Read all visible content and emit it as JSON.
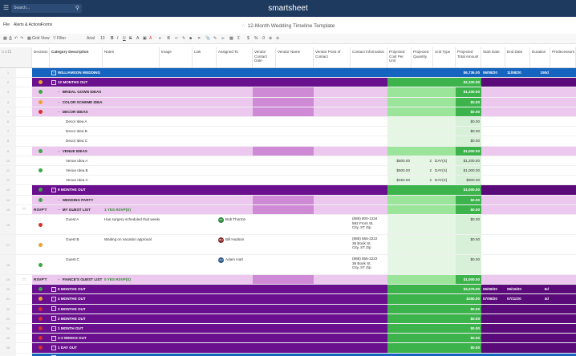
{
  "app": {
    "brand": "smartsheet",
    "search_placeholder": "Search...",
    "sheet_title": "12-Month Wedding Timeline Template"
  },
  "menu": [
    "File",
    "Alerts & Actions",
    "Forms"
  ],
  "toolbar": {
    "grid_view": "Grid View",
    "filter": "Filter",
    "font": "Arial",
    "font_size": "10"
  },
  "columns": [
    "Decision",
    "Category Description",
    "Notes",
    "Image",
    "Link",
    "Assigned To",
    "Vendor Contact Date",
    "Vendor Name",
    "Vendor Point of Contact",
    "Contact Information",
    "Projected Cost Per Unit",
    "Projected Quantity",
    "Unit Type",
    "Projected Total Amount",
    "Start Date",
    "End Date",
    "Duration",
    "Predecessors"
  ],
  "colors": {
    "purple_dark": "#6a0f8e",
    "purple_light": "#ecc8ef",
    "blue_header": "#1565c0",
    "green_mid": "#3cb44b",
    "green_light": "#9be59b",
    "green_pale": "#e5f6e5"
  },
  "rows": [
    {
      "num": "1",
      "type": "blue",
      "indicator": "",
      "decision": "",
      "category": "WILLIAMSON WEDDING",
      "notes": "",
      "assigned": "",
      "contact": "",
      "cost": "",
      "qty": "",
      "unit": "",
      "total": "$6,736.00",
      "start": "06/08/20",
      "end": "11/08/20",
      "duration": "150d"
    },
    {
      "num": "2",
      "type": "dark",
      "indicator": "orange",
      "decision": "",
      "category": "12 MONTHS OUT",
      "notes": "",
      "assigned": "",
      "contact": "",
      "cost": "",
      "qty": "",
      "unit": "",
      "total": "$2,100.00",
      "start": "",
      "end": "",
      "duration": ""
    },
    {
      "num": "3",
      "type": "light",
      "indicator": "green",
      "decision": "",
      "category": "BRIDAL GOWN IDEAS",
      "notes": "",
      "assigned": "",
      "contact": "",
      "cost": "",
      "qty": "",
      "unit": "",
      "total": "$1,100.00",
      "start": "",
      "end": "",
      "duration": ""
    },
    {
      "num": "4",
      "type": "light",
      "indicator": "orange",
      "decision": "",
      "category": "COLOR SCHEME IDEAS",
      "notes": "",
      "assigned": "",
      "contact": "",
      "cost": "",
      "qty": "",
      "unit": "",
      "total": "$0.00",
      "start": "",
      "end": "",
      "duration": ""
    },
    {
      "num": "5",
      "type": "light",
      "indicator": "red",
      "decision": "",
      "category": "DECOR IDEAS",
      "notes": "",
      "assigned": "",
      "contact": "",
      "cost": "",
      "qty": "",
      "unit": "",
      "total": "$0.00",
      "start": "",
      "end": "",
      "duration": ""
    },
    {
      "num": "6",
      "type": "white",
      "indicator": "",
      "decision": "",
      "category": "Decor Idea A",
      "notes": "",
      "assigned": "",
      "contact": "",
      "cost": "",
      "qty": "",
      "unit": "",
      "total": "$0.00",
      "start": "",
      "end": "",
      "duration": ""
    },
    {
      "num": "7",
      "type": "white",
      "indicator": "",
      "decision": "",
      "category": "Decor Idea B",
      "notes": "",
      "assigned": "",
      "contact": "",
      "cost": "",
      "qty": "",
      "unit": "",
      "total": "$0.00",
      "start": "",
      "end": "",
      "duration": ""
    },
    {
      "num": "8",
      "type": "white",
      "indicator": "",
      "decision": "",
      "category": "Decor Idea C",
      "notes": "",
      "assigned": "",
      "contact": "",
      "cost": "",
      "qty": "",
      "unit": "",
      "total": "$0.00",
      "start": "",
      "end": "",
      "duration": ""
    },
    {
      "num": "9",
      "type": "light",
      "indicator": "green",
      "decision": "",
      "category": "VENUE IDEAS",
      "notes": "",
      "assigned": "",
      "contact": "",
      "cost": "",
      "qty": "",
      "unit": "",
      "total": "$1,000.00",
      "start": "",
      "end": "",
      "duration": ""
    },
    {
      "num": "10",
      "type": "white",
      "indicator": "",
      "decision": "",
      "category": "Venue Idea A",
      "notes": "",
      "assigned": "",
      "contact": "",
      "cost": "$600.00",
      "qty": "2",
      "unit": "DAY(S)",
      "total": "$1,200.00",
      "start": "",
      "end": "",
      "duration": ""
    },
    {
      "num": "11",
      "type": "white",
      "indicator": "green",
      "decision": "",
      "category": "Venue Idea B",
      "notes": "",
      "assigned": "",
      "contact": "",
      "cost": "$500.00",
      "qty": "2",
      "unit": "DAY(S)",
      "total": "$1,000.00",
      "start": "",
      "end": "",
      "duration": ""
    },
    {
      "num": "12",
      "type": "white",
      "indicator": "",
      "decision": "",
      "category": "Venue Idea C",
      "notes": "",
      "assigned": "",
      "contact": "",
      "cost": "$450.00",
      "qty": "2",
      "unit": "DAY(S)",
      "total": "$900.00",
      "start": "",
      "end": "",
      "duration": ""
    },
    {
      "num": "13",
      "type": "dark",
      "indicator": "green",
      "decision": "",
      "category": "9 MONTHS OUT",
      "notes": "",
      "assigned": "",
      "contact": "",
      "cost": "",
      "qty": "",
      "unit": "",
      "total": "$1,000.00",
      "start": "",
      "end": "",
      "duration": ""
    },
    {
      "num": "14",
      "type": "light",
      "indicator": "green",
      "decision": "",
      "category": "WEDDING PARTY",
      "notes": "",
      "assigned": "",
      "contact": "",
      "cost": "",
      "qty": "",
      "unit": "",
      "total": "$0.00",
      "start": "",
      "end": "",
      "duration": ""
    },
    {
      "num": "15",
      "type": "light",
      "indicator": "",
      "decision": "RSVP'T",
      "category": "MY GUEST LIST",
      "notes": "1 YES RSVP(S)",
      "assigned": "",
      "contact": "",
      "cost": "",
      "qty": "",
      "unit": "",
      "total": "$0.00",
      "start": "",
      "end": "",
      "duration": ""
    },
    {
      "num": "16",
      "type": "white",
      "indicator": "red",
      "decision": "",
      "category": "Guest A",
      "notes": "Has surgery scheduled that weekend",
      "assigned": "Bob Thorton",
      "contact": "(888) 800-1234\n592 Front St.\nCity, ST Zip",
      "cost": "",
      "qty": "",
      "unit": "",
      "total": "$0.00",
      "start": "",
      "end": "",
      "duration": "",
      "tall": true
    },
    {
      "num": "17",
      "type": "white",
      "indicator": "orange",
      "decision": "",
      "category": "Guest B",
      "notes": "Waiting on vacation approval",
      "assigned": "Bill Hudson",
      "contact": "(888) 555-2222\n39 Book St.\nCity, ST Zip",
      "cost": "",
      "qty": "",
      "unit": "",
      "total": "$0.00",
      "start": "",
      "end": "",
      "duration": "",
      "tall": true
    },
    {
      "num": "18",
      "type": "white",
      "indicator": "green",
      "decision": "",
      "category": "Guest C",
      "notes": "",
      "assigned": "Adam Hart",
      "contact": "(888) 555-2222\n39 Book St.\nCity, ST Zip",
      "cost": "",
      "qty": "",
      "unit": "",
      "total": "$0.00",
      "start": "",
      "end": "",
      "duration": "",
      "tall": true
    },
    {
      "num": "19",
      "type": "light",
      "indicator": "",
      "decision": "RSVP'T",
      "category": "FIANCE'S GUEST LIST",
      "notes": "0 YES RSVP(S)",
      "assigned": "",
      "contact": "",
      "cost": "",
      "qty": "",
      "unit": "",
      "total": "$1,000.00",
      "start": "",
      "end": "",
      "duration": ""
    },
    {
      "num": "20",
      "type": "dark",
      "indicator": "green",
      "decision": "",
      "category": "6 MONTHS OUT",
      "notes": "",
      "assigned": "",
      "contact": "",
      "cost": "",
      "qty": "",
      "unit": "",
      "total": "$3,376.00",
      "start": "06/08/20",
      "end": "06/15/20",
      "duration": "6d"
    },
    {
      "num": "21",
      "type": "dark",
      "indicator": "orange",
      "decision": "",
      "category": "4 MONTHS OUT",
      "notes": "",
      "assigned": "",
      "contact": "",
      "cost": "",
      "qty": "",
      "unit": "",
      "total": "$250.00",
      "start": "07/08/20",
      "end": "07/11/20",
      "duration": "3d"
    },
    {
      "num": "22",
      "type": "dark",
      "indicator": "red",
      "decision": "",
      "category": "3 MONTHS OUT",
      "notes": "",
      "assigned": "",
      "contact": "",
      "cost": "",
      "qty": "",
      "unit": "",
      "total": "$0.00",
      "start": "",
      "end": "",
      "duration": ""
    },
    {
      "num": "23",
      "type": "dark",
      "indicator": "red",
      "decision": "",
      "category": "2 MONTHS OUT",
      "notes": "",
      "assigned": "",
      "contact": "",
      "cost": "",
      "qty": "",
      "unit": "",
      "total": "$0.00",
      "start": "",
      "end": "",
      "duration": ""
    },
    {
      "num": "24",
      "type": "dark",
      "indicator": "red",
      "decision": "",
      "category": "1 MONTH OUT",
      "notes": "",
      "assigned": "",
      "contact": "",
      "cost": "",
      "qty": "",
      "unit": "",
      "total": "$0.00",
      "start": "",
      "end": "",
      "duration": ""
    },
    {
      "num": "25",
      "type": "dark",
      "indicator": "red",
      "decision": "",
      "category": "1-2 WEEKS OUT",
      "notes": "",
      "assigned": "",
      "contact": "",
      "cost": "",
      "qty": "",
      "unit": "",
      "total": "$0.00",
      "start": "",
      "end": "",
      "duration": ""
    },
    {
      "num": "26",
      "type": "dark",
      "indicator": "red",
      "decision": "",
      "category": "1 DAY OUT",
      "notes": "",
      "assigned": "",
      "contact": "",
      "cost": "",
      "qty": "",
      "unit": "",
      "total": "$0.00",
      "start": "",
      "end": "",
      "duration": ""
    },
    {
      "num": "27",
      "type": "blue",
      "indicator": "",
      "decision": "",
      "category": "WEDDING DAY",
      "notes": "",
      "assigned": "",
      "contact": "",
      "cost": "",
      "qty": "",
      "unit": "",
      "total": "$0.00",
      "start": "11/08/20",
      "end": "11/08/20",
      "duration": "~0"
    }
  ]
}
